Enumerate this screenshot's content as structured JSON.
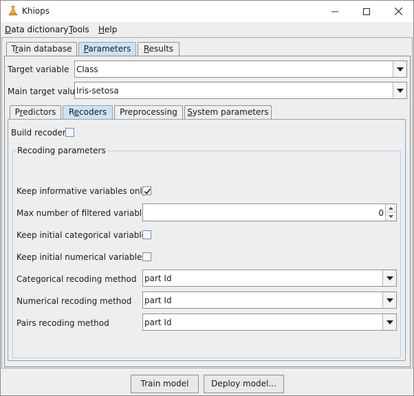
{
  "window": {
    "title": "Khiops",
    "icon": "khiops-flask-icon"
  },
  "menu": {
    "items": [
      {
        "label": "Data dictionary",
        "mnemonic": "D"
      },
      {
        "label": "Tools",
        "mnemonic": "T"
      },
      {
        "label": "Help",
        "mnemonic": "H"
      }
    ]
  },
  "main_tabs": [
    {
      "label": "Train database",
      "active": false
    },
    {
      "label": "Parameters",
      "active": true
    },
    {
      "label": "Results",
      "active": false
    }
  ],
  "target_variable": {
    "label": "Target variable",
    "value": "Class"
  },
  "main_target_value": {
    "label": "Main target value",
    "value": "Iris-setosa"
  },
  "sub_tabs": [
    {
      "label": "Predictors",
      "active": false
    },
    {
      "label": "Recoders",
      "active": true
    },
    {
      "label": "Preprocessing",
      "active": false
    },
    {
      "label": "System parameters",
      "active": false
    }
  ],
  "recoders": {
    "build_recoder": {
      "label": "Build recoder",
      "checked": false
    },
    "group_title": "Recoding parameters",
    "keep_informative": {
      "label": "Keep informative variables only",
      "checked": true
    },
    "max_filtered": {
      "label": "Max number of filtered variables",
      "value": "0"
    },
    "keep_categorical": {
      "label": "Keep initial categorical variables",
      "checked": false
    },
    "keep_numerical": {
      "label": "Keep initial numerical variables",
      "checked": false
    },
    "categorical_method": {
      "label": "Categorical recoding method",
      "value": "part Id"
    },
    "numerical_method": {
      "label": "Numerical recoding method",
      "value": "part Id"
    },
    "pairs_method": {
      "label": "Pairs recoding method",
      "value": "part Id"
    }
  },
  "buttons": {
    "train": "Train model",
    "deploy": "Deploy model..."
  },
  "colors": {
    "active_tab": "#cfe1f3",
    "panel_border": "#7fa7cf",
    "window_bg": "#eeeeee"
  }
}
